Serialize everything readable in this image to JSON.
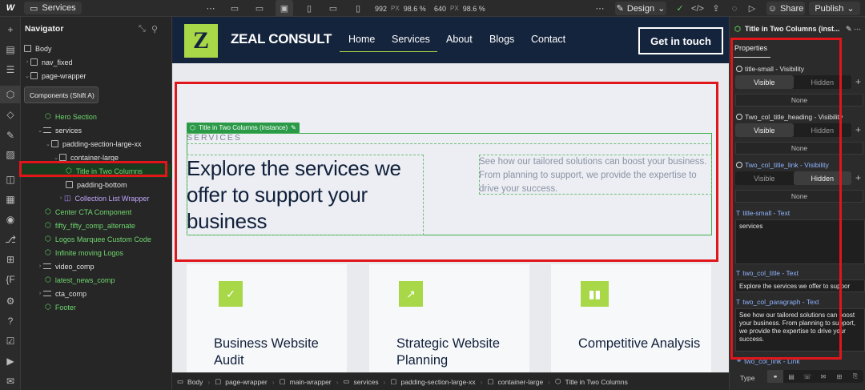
{
  "topbar": {
    "logo": "W",
    "page_name": "Services",
    "width_value": "992",
    "width_unit": "PX",
    "width_zoom": "98.6 %",
    "height_value": "640",
    "height_unit": "PX",
    "height_zoom": "98.6 %",
    "mode_label": "Design",
    "share_label": "Share",
    "publish_label": "Publish"
  },
  "tooltip": "Components (Shift A)",
  "navigator": {
    "title": "Navigator",
    "items": [
      {
        "label": "Body"
      },
      {
        "label": "nav_fixed"
      },
      {
        "label": "page-wrapper"
      },
      {
        "label": "Hero Section"
      },
      {
        "label": "services"
      },
      {
        "label": "padding-section-large-xx"
      },
      {
        "label": "container-large"
      },
      {
        "label": "Title in Two Columns"
      },
      {
        "label": "padding-bottom"
      },
      {
        "label": "Collection List Wrapper"
      },
      {
        "label": "Center CTA Component"
      },
      {
        "label": "fifty_fifty_comp_alternate"
      },
      {
        "label": "Logos Marquee Custom Code"
      },
      {
        "label": "Infinite moving Logos"
      },
      {
        "label": "video_comp"
      },
      {
        "label": "latest_news_comp"
      },
      {
        "label": "cta_comp"
      },
      {
        "label": "Footer"
      }
    ]
  },
  "site": {
    "brand": "ZEAL CONSULT",
    "logo_letter": "Z",
    "menu": [
      "Home",
      "Services",
      "About",
      "Blogs",
      "Contact"
    ],
    "cta": "Get in touch",
    "instance_tag": "Title in Two Columns (instance)",
    "eyebrow": "SERVICES",
    "title": "Explore the services we offer to support your business",
    "paragraph": "See how our tailored solutions can boost your business. From planning to support, we provide the expertise to drive your success.",
    "cards": [
      {
        "title": "Business Website Audit",
        "icon": "shield-check-icon"
      },
      {
        "title": "Strategic Website Planning",
        "icon": "trend-chart-icon"
      },
      {
        "title": "Competitive Analysis",
        "icon": "bar-chart-icon"
      }
    ]
  },
  "breadcrumb": [
    "Body",
    "page-wrapper",
    "main-wrapper",
    "services",
    "padding-section-large-xx",
    "container-large",
    "Title in Two Columns"
  ],
  "properties": {
    "header": "Title in Two Columns (inst...",
    "tab": "Properties",
    "groups": [
      {
        "label": "title-small - Visibility",
        "visible": "Visible",
        "hidden": "Hidden",
        "none": "None"
      },
      {
        "label": "Two_col_title_heading - Visibility",
        "visible": "Visible",
        "hidden": "Hidden",
        "none": "None"
      },
      {
        "label": "Two_col_title_link - Visibility",
        "visible": "Visible",
        "hidden": "Hidden",
        "none": "None"
      }
    ],
    "text_fields": [
      {
        "label": "title-small - Text",
        "value": "services"
      },
      {
        "label": "two_col_title - Text",
        "value": "Explore the services we offer to suppor"
      },
      {
        "label": "two_col_paragraph - Text",
        "value": "See how our tailored solutions can boost your business. From planning to support, we provide the expertise to drive your success."
      }
    ],
    "link_label": "two_col_link - Link",
    "type_label": "Type"
  },
  "colors": {
    "accent_green": "#a8d848",
    "nav_navy": "#15243d",
    "annotation_red": "#e0161b",
    "selection_green": "#2b9a48"
  }
}
